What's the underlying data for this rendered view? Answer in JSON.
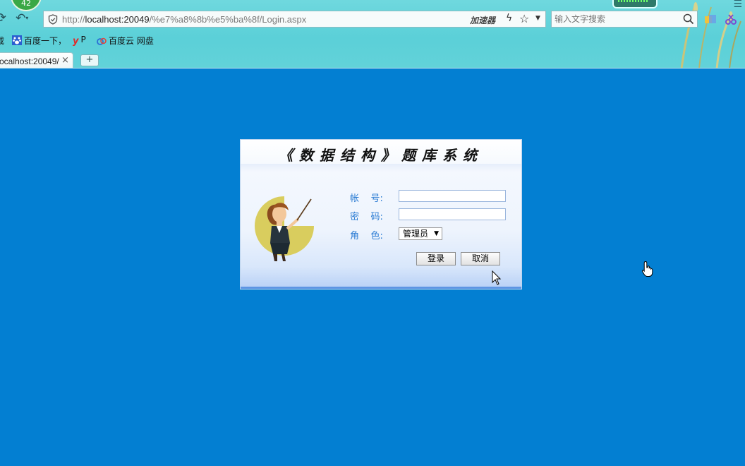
{
  "browser": {
    "badge": "42",
    "address": {
      "url_prefix": "http://",
      "url_host": "localhost:20049",
      "url_path": "/%e7%a8%8b%e5%ba%8f/Login.aspx",
      "accelerator_label": "加速器"
    },
    "search": {
      "placeholder": "输入文字搜索"
    },
    "bookmarks": [
      {
        "label": "载"
      },
      {
        "label": "百度一下，"
      },
      {
        "label": "P"
      },
      {
        "label": "百度云 网盘"
      }
    ],
    "tab": {
      "title": "ocalhost:20049/",
      "close": "×"
    },
    "new_tab": "+"
  },
  "login": {
    "title": "《数据结构》题库系统",
    "fields": {
      "account_label": "帐    号:",
      "account_value": "",
      "password_label": "密    码:",
      "password_value": "",
      "role_label": "角    色:",
      "role_value": "管理员"
    },
    "buttons": {
      "login": "登录",
      "cancel": "取消"
    }
  },
  "colors": {
    "page_background": "#037fd2",
    "chrome_background": "#5bd0d8",
    "label_blue": "#2a7bd3"
  }
}
